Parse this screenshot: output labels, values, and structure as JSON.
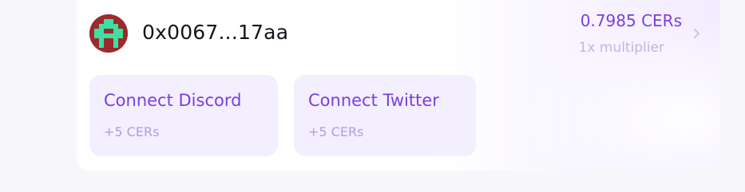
{
  "account": {
    "wallet_address": "0x0067...17aa",
    "balance": "0.7985 CERs",
    "multiplier": "1x multiplier"
  },
  "tasks": [
    {
      "title": "Connect Discord",
      "reward": "+5 CERs"
    },
    {
      "title": "Connect Twitter",
      "reward": "+5 CERs"
    }
  ],
  "icons": {
    "avatar": "pixel-identicon",
    "chevron": "chevron-right-icon"
  },
  "colors": {
    "accent": "#7a3ee0",
    "accent_muted": "#c4b3e6",
    "task_background": "#f4efff",
    "avatar_background": "#9b2a2e",
    "avatar_foreground": "#3de0a0"
  }
}
